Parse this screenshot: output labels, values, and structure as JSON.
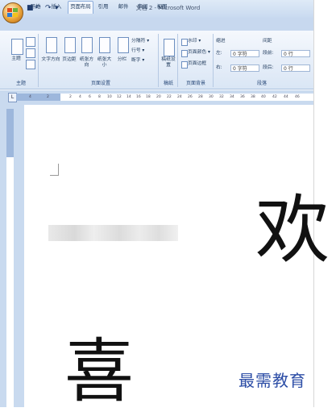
{
  "window": {
    "title": "文档 2 - Microsoft Word"
  },
  "quick_access": {
    "save": "■",
    "undo": "↶",
    "redo": "↷",
    "more": "▾"
  },
  "tabs": [
    "开始",
    "插入",
    "页面布局",
    "引用",
    "邮件",
    "审阅",
    "视图"
  ],
  "active_tab": "页面布局",
  "ribbon": {
    "theme_group": {
      "label": "主题",
      "buttons": [
        "主题"
      ]
    },
    "page_setup_group": {
      "label": "页面设置",
      "buttons": [
        "文字方向",
        "页边距",
        "纸张方向",
        "纸张大小",
        "分栏"
      ],
      "small_buttons": [
        "分隔符 ▾",
        "行号 ▾",
        "断字 ▾"
      ]
    },
    "draft_group": {
      "label": "稿纸",
      "buttons": [
        "稿纸设置"
      ]
    },
    "background_group": {
      "label": "页面背景",
      "small_buttons": [
        "水印 ▾",
        "页面颜色 ▾",
        "页面边框"
      ]
    },
    "paragraph_group": {
      "label": "段落",
      "indent_header": "缩进",
      "spacing_header": "间距",
      "indent_left_label": "左:",
      "indent_left_value": "0 字符",
      "indent_right_label": "右:",
      "indent_right_value": "0 字符",
      "spacing_before_label": "段前:",
      "spacing_before_value": "0 行",
      "spacing_after_label": "段后:",
      "spacing_after_value": "0 行"
    }
  },
  "ruler": {
    "ticks": [
      "4",
      "2",
      "2",
      "4",
      "6",
      "8",
      "10",
      "12",
      "14",
      "16",
      "18",
      "20",
      "22",
      "24",
      "26",
      "28",
      "30",
      "32",
      "34",
      "36",
      "38",
      "40",
      "42",
      "44",
      "46"
    ]
  },
  "document": {
    "char_1": "欢",
    "char_2": "喜"
  },
  "watermark": {
    "text": "最需教育"
  }
}
